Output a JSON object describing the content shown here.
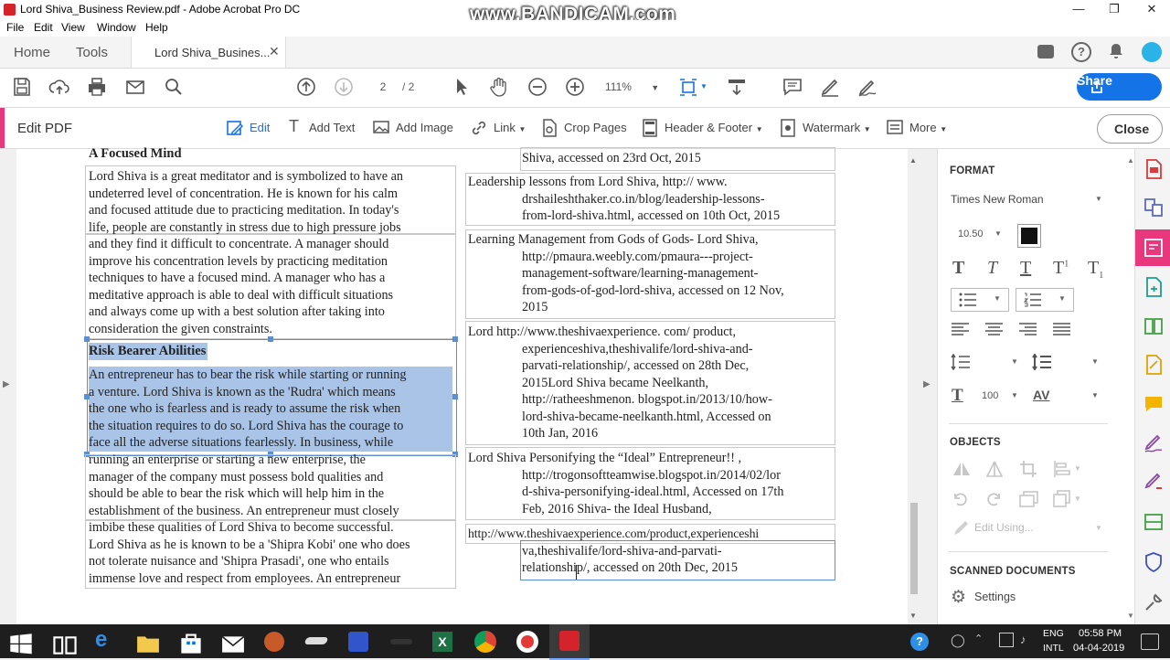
{
  "window": {
    "title": "Lord Shiva_Business Review.pdf - Adobe Acrobat Pro DC",
    "watermark": "www.BANDICAM.com"
  },
  "menu": [
    "File",
    "Edit",
    "View",
    "Window",
    "Help"
  ],
  "tabs": {
    "home": "Home",
    "tools": "Tools",
    "doc": "Lord Shiva_Busines..."
  },
  "toolbar": {
    "page_current": "2",
    "page_total": "/ 2",
    "zoom": "111%",
    "share": "Share"
  },
  "editbar": {
    "title": "Edit PDF",
    "tools": [
      "Edit",
      "Add Text",
      "Add Image",
      "Link",
      "Crop Pages",
      "Header & Footer",
      "Watermark",
      "More"
    ],
    "close": "Close"
  },
  "doc": {
    "left": {
      "heading1": "A Focused Mind",
      "para1_lines": [
        "Lord Shiva is a great meditator and is symbolized to have an",
        "undeterred level of concentration. He is known for his calm",
        "and focused attitude due to practicing meditation. In today's",
        "life, people are constantly in stress due to high pressure jobs",
        "and they find it difficult to concentrate. A manager should",
        "improve his concentration levels by practicing meditation",
        "techniques to have a focused mind. A manager who has a",
        "meditative approach is able to deal with difficult situations",
        "and always come up with a best solution after taking into",
        "consideration the given constraints."
      ],
      "heading2": "Risk Bearer Abilities",
      "para2_lines": [
        "An entrepreneur has to bear the risk while starting or running",
        "a venture. Lord Shiva is known as the 'Rudra' which means",
        "the one who is fearless and is ready to assume the risk when",
        "the situation requires to do so. Lord Shiva has the courage to",
        "face all the adverse situations fearlessly. In business, while"
      ],
      "para3_lines": [
        "running an enterprise or starting a new enterprise, the",
        "manager of the company must possess bold qualities and",
        "should be able to bear the risk which will help him in the",
        "establishment of the business. An entrepreneur must closely",
        "imbibe these qualities of Lord Shiva to become successful.",
        "Lord Shiva as he is known to be a 'Shipra Kobi' one who does",
        "not tolerate nuisance and 'Shipra Prasadi', one who entails",
        "immense love and respect from employees. An entrepreneur"
      ]
    },
    "right": {
      "ref0": "Shiva, accessed on 23rd Oct, 2015",
      "ref1": [
        "Leadership lessons from Lord Shiva, http:// www.",
        "drshaileshthaker.co.in/blog/leadership-lessons-",
        "from-lord-shiva.html, accessed on 10th Oct, 2015"
      ],
      "ref2": [
        "Learning Management from Gods of Gods- Lord Shiva,",
        "http://pmaura.weebly.com/pmaura---project-",
        "management-software/learning-management-",
        "from-gods-of-god-lord-shiva, accessed on 12 Nov,",
        "2015"
      ],
      "ref3": [
        "Lord http://www.theshivaexperience. com/ product,",
        "experienceshiva,theshivalife/lord-shiva-and-",
        "parvati-relationship/, accessed on 28th Dec,",
        "2015Lord Shiva became Neelkanth,",
        "http://ratheeshmenon. blogspot.in/2013/10/how-",
        "lord-shiva-became-neelkanth.html, Accessed on",
        "10th Jan, 2016"
      ],
      "ref4": [
        "Lord Shiva Personifying the “Ideal” Entrepreneur!! ,",
        "http://trogonsoftteamwise.blogspot.in/2014/02/lor",
        "d-shiva-personifying-ideal.html, Accessed on 17th",
        "Feb, 2016 Shiva- the Ideal Husband,"
      ],
      "ref5": [
        "http://www.theshivaexperience.com/product,experienceshi",
        "va,theshivalife/lord-shiva-and-parvati-",
        "relationship/, accessed on 20th Dec, 2015"
      ]
    }
  },
  "panel": {
    "format_title": "FORMAT",
    "font": "Times New Roman",
    "font_size": "10.50",
    "text_color": "#111111",
    "scale": "100",
    "objects_title": "OBJECTS",
    "edit_using": "Edit Using...",
    "scanned_title": "SCANNED DOCUMENTS",
    "settings": "Settings"
  },
  "taskbar": {
    "lang1": "ENG",
    "lang2": "INTL",
    "time": "05:58 PM",
    "date": "04-04-2019"
  }
}
